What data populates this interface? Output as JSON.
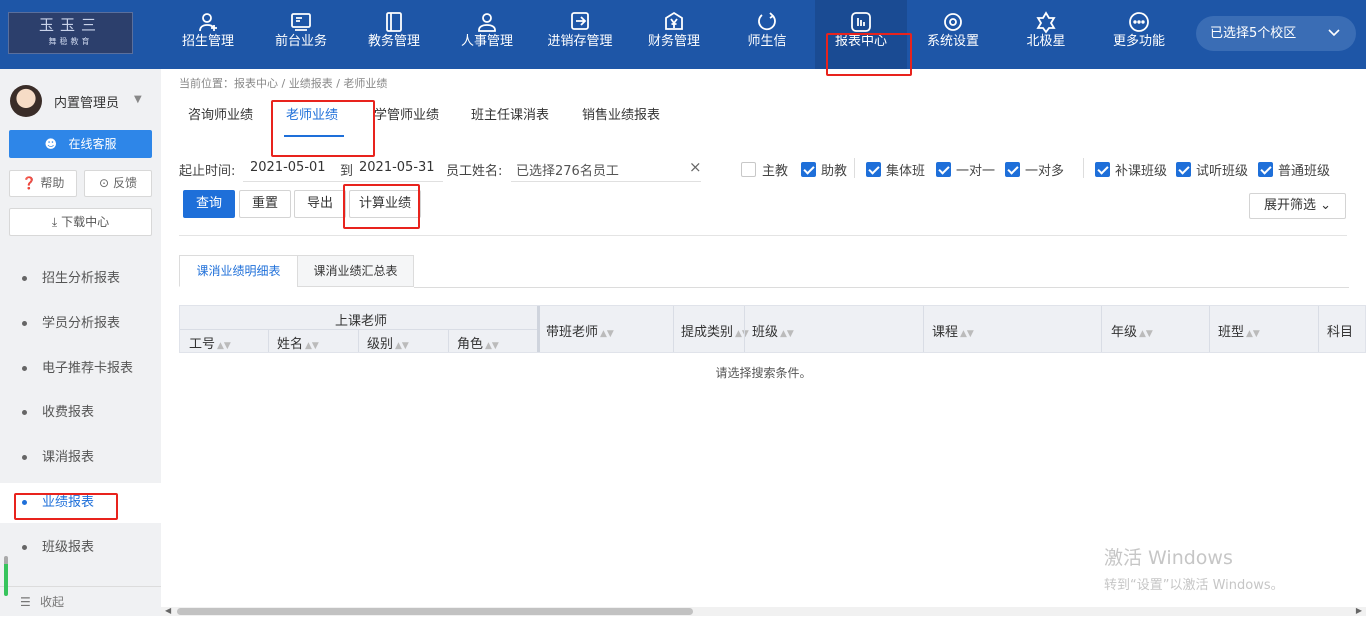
{
  "logo": {
    "text": "玉玉三",
    "sub": "舞稳教育"
  },
  "nav": [
    {
      "label": "招生管理",
      "icon": "user-add-icon"
    },
    {
      "label": "前台业务",
      "icon": "monitor-icon"
    },
    {
      "label": "教务管理",
      "icon": "book-icon"
    },
    {
      "label": "人事管理",
      "icon": "person-icon"
    },
    {
      "label": "进销存管理",
      "icon": "arrow-box-icon"
    },
    {
      "label": "财务管理",
      "icon": "yen-icon"
    },
    {
      "label": "师生信",
      "icon": "chat-icon"
    },
    {
      "label": "报表中心",
      "icon": "chart-icon"
    },
    {
      "label": "系统设置",
      "icon": "gear-icon"
    },
    {
      "label": "北极星",
      "icon": "star-icon"
    },
    {
      "label": "更多功能",
      "icon": "more-icon"
    }
  ],
  "campus": {
    "label": "已选择5个校区"
  },
  "user": {
    "name": "内置管理员"
  },
  "sidebar": {
    "service": "在线客服",
    "help": "帮助",
    "feedback": "反馈",
    "download": "下载中心",
    "items": [
      {
        "label": "招生分析报表"
      },
      {
        "label": "学员分析报表"
      },
      {
        "label": "电子推荐卡报表"
      },
      {
        "label": "收费报表"
      },
      {
        "label": "课消报表"
      },
      {
        "label": "业绩报表"
      },
      {
        "label": "班级报表"
      }
    ],
    "collapse": "收起"
  },
  "breadcrumb": "当前位置：报表中心 / 业绩报表 / 老师业绩",
  "tabs": [
    "咨询师业绩",
    "老师业绩",
    "学管师业绩",
    "班主任课消表",
    "销售业绩报表"
  ],
  "filters": {
    "date_label": "起止时间:",
    "start": "2021-05-01",
    "to": "到",
    "end": "2021-05-31",
    "staff_label": "员工姓名:",
    "staff_value": "已选择276名员工",
    "clear": "×",
    "checks": [
      {
        "label": "主教",
        "checked": false
      },
      {
        "label": "助教",
        "checked": true
      },
      {
        "label": "集体班",
        "checked": true
      },
      {
        "label": "一对一",
        "checked": true
      },
      {
        "label": "一对多",
        "checked": true
      },
      {
        "label": "补课班级",
        "checked": true
      },
      {
        "label": "试听班级",
        "checked": true
      },
      {
        "label": "普通班级",
        "checked": true
      }
    ]
  },
  "buttons": {
    "query": "查询",
    "reset": "重置",
    "export": "导出",
    "calc": "计算业绩",
    "expand": "展开筛选"
  },
  "subtabs": [
    "课消业绩明细表",
    "课消业绩汇总表"
  ],
  "table": {
    "group": "上课老师",
    "sub_cols": [
      "工号",
      "姓名",
      "级别",
      "角色"
    ],
    "cols": [
      "带班老师",
      "提成类别",
      "班级",
      "课程",
      "年级",
      "班型",
      "科目"
    ],
    "empty": "请选择搜索条件。"
  },
  "watermark": {
    "line1": "激活 Windows",
    "line2": "转到“设置”以激活 Windows。"
  }
}
